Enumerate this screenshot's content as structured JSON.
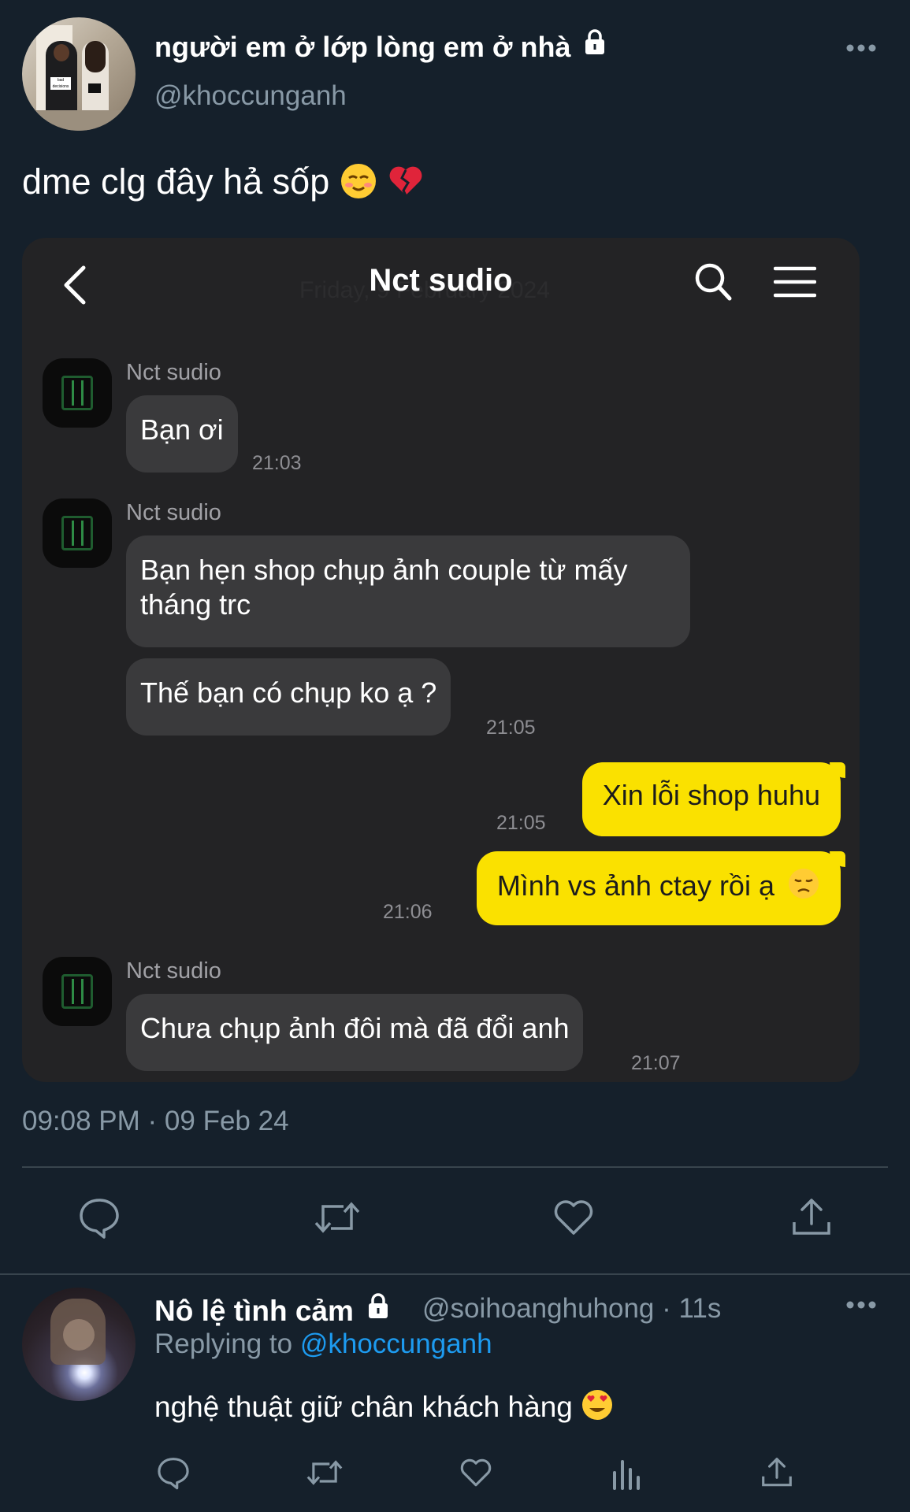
{
  "tweet": {
    "display_name": "người em ở lớp lòng em ở nhà",
    "handle": "@khoccunganh",
    "text": "dme clg đây hả sốp",
    "timestamp": "09:08 PM · 09 Feb 24",
    "avatar_tag_text": "bad decisions"
  },
  "chat": {
    "title": "Nct sudio",
    "ghost_date": "Friday, 9 February 2024",
    "messages": [
      {
        "sender": "Nct sudio",
        "text": "Bạn ơi",
        "time": "21:03"
      },
      {
        "sender": "Nct sudio",
        "text": "Bạn hẹn shop chụp ảnh couple từ mấy tháng trc"
      },
      {
        "text": "Thế bạn có chụp ko ạ ?",
        "time": "21:05"
      },
      {
        "outgoing": true,
        "text": "Xin lỗi shop huhu",
        "time": "21:05"
      },
      {
        "outgoing": true,
        "text": "Mình vs ảnh ctay rồi ạ",
        "time": "21:06"
      },
      {
        "sender": "Nct sudio",
        "text": "Chưa chụp ảnh đôi mà đã đổi anh",
        "time": "21:07"
      }
    ]
  },
  "reply": {
    "display_name": "Nô lệ tình cảm",
    "handle": "@soihoanghuhong",
    "age": "· 11s",
    "replying_label": "Replying to",
    "replying_handle": "@khoccunganh",
    "text": "nghệ thuật giữ chân khách hàng"
  },
  "icons": {
    "more": "more-dots-icon",
    "lock": "lock-icon",
    "reply": "reply-bubble-icon",
    "retweet": "retweet-icon",
    "like": "heart-icon",
    "share": "share-upload-icon",
    "stats": "bar-chart-icon"
  },
  "colors": {
    "background": "#15202b",
    "secondary_text": "#8899a6",
    "link": "#1d9bf0",
    "chat_bg": "#232325",
    "chat_in_bubble": "#3a3a3c",
    "chat_out_bubble": "#fae100"
  }
}
